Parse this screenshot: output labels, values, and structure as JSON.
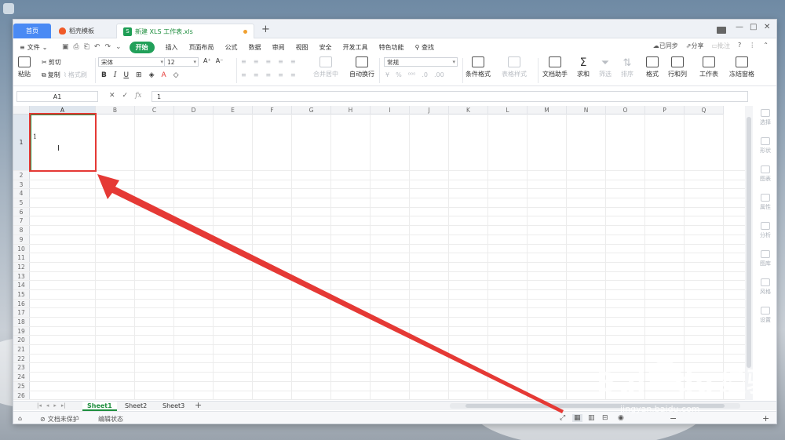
{
  "tabs": {
    "home": "首页",
    "templates": "稻壳模板",
    "document": "新建 XLS 工作表.xls",
    "add": "+"
  },
  "menu": {
    "file": "文件",
    "items": [
      "开始",
      "插入",
      "页面布局",
      "公式",
      "数据",
      "审阅",
      "视图",
      "安全",
      "开发工具",
      "特色功能"
    ],
    "search": "查找",
    "sync": "已同步",
    "share": "分享",
    "comment": "批注"
  },
  "ribbon": {
    "paste": "粘贴",
    "cut": "剪切",
    "copy": "复制",
    "format_painter": "格式刷",
    "font_name": "宋体",
    "font_size": "12",
    "merge_center": "合并居中",
    "wrap_text": "自动换行",
    "number_format": "常规",
    "conditional_format": "条件格式",
    "table_style": "表格样式",
    "doc_assistant": "文档助手",
    "sum": "求和",
    "filter": "筛选",
    "sort": "排序",
    "format": "格式",
    "rows_cols": "行和列",
    "worksheet": "工作表",
    "freeze": "冻结窗格"
  },
  "formula_bar": {
    "name_box": "A1",
    "fx": "fx",
    "content": "1"
  },
  "grid": {
    "columns": [
      "A",
      "B",
      "C",
      "D",
      "E",
      "F",
      "G",
      "H",
      "I",
      "J",
      "K",
      "L",
      "M",
      "N",
      "O",
      "P",
      "Q"
    ],
    "rows": [
      "1",
      "2",
      "3",
      "4",
      "5",
      "6",
      "7",
      "8",
      "9",
      "10",
      "11",
      "12",
      "13",
      "14",
      "15",
      "16",
      "17",
      "18",
      "19",
      "20",
      "21",
      "22",
      "23",
      "24",
      "25",
      "26"
    ],
    "a1_value": "1"
  },
  "side_panel": [
    "选择",
    "形状",
    "图表",
    "属性",
    "分析",
    "图库",
    "风格",
    "设置"
  ],
  "sheets": [
    "Sheet1",
    "Sheet2",
    "Sheet3"
  ],
  "status": {
    "protect": "文档未保护",
    "edit_state": "编辑状态"
  },
  "watermark": {
    "brand": "Bai",
    "brand2": "du",
    "cn": "经验",
    "url": "jingyan.baidu.com"
  },
  "colors": {
    "accent_green": "#1e8e3e",
    "home_tab_blue": "#4a8af4",
    "annotation_red": "#e53935"
  }
}
